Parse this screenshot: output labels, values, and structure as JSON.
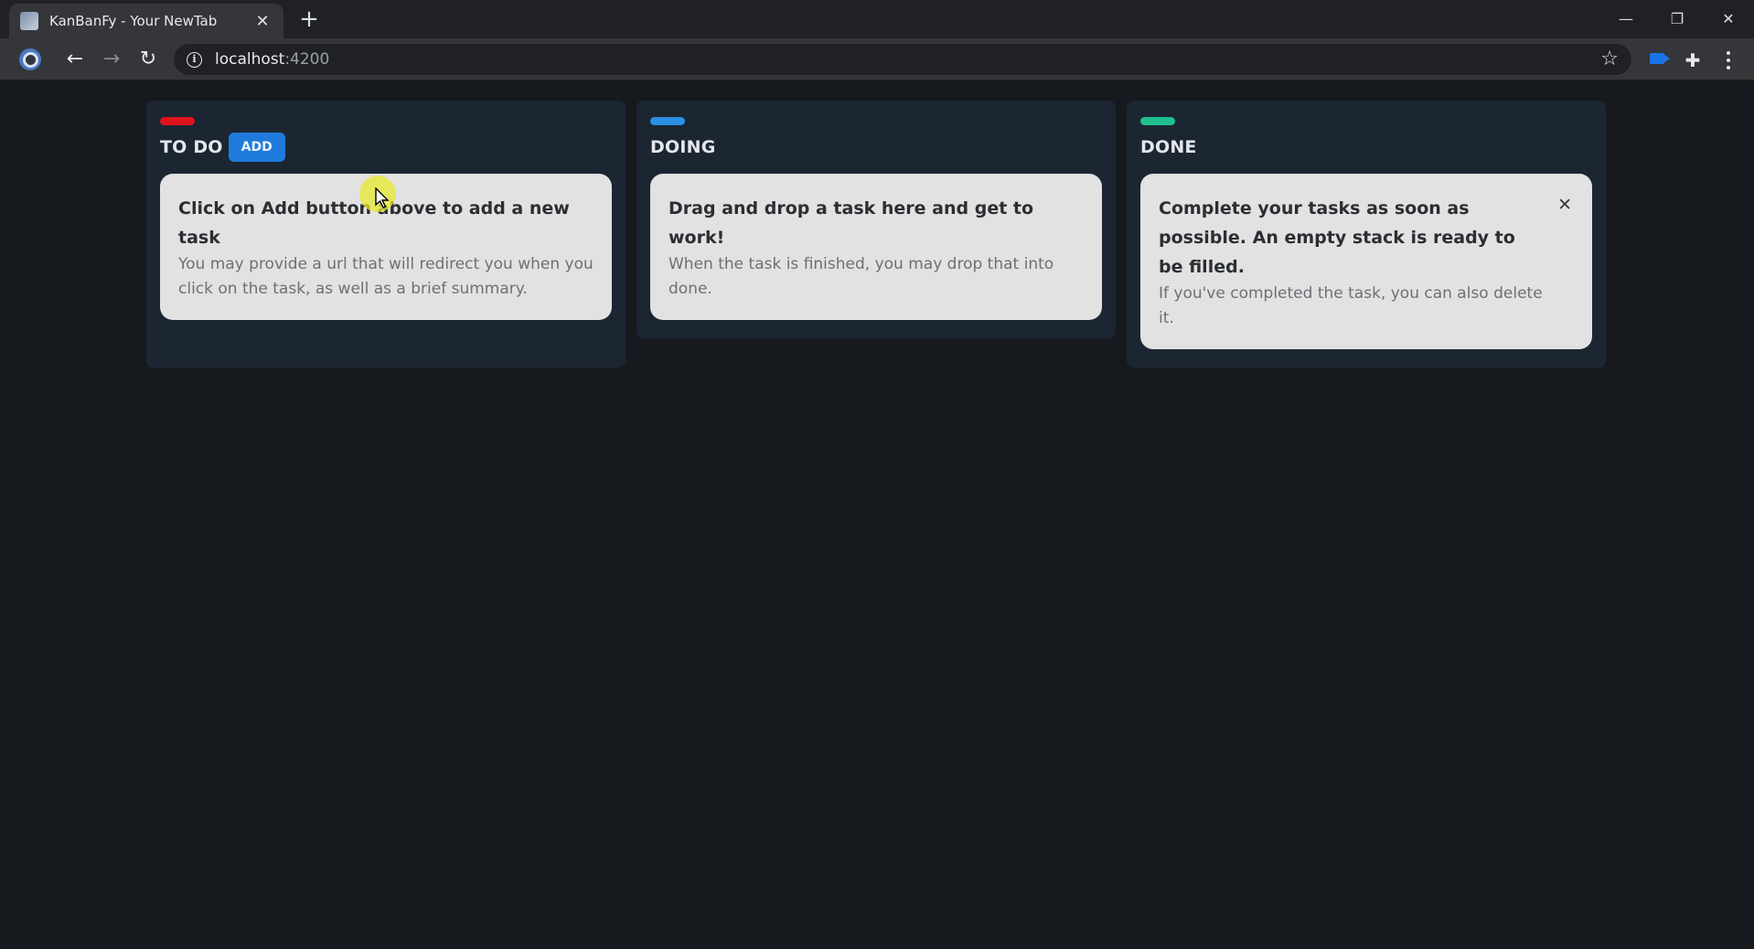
{
  "browser": {
    "tab_title": "KanBanFy - Your NewTab",
    "tab_close": "✕",
    "new_tab": "+",
    "url_host": "localhost",
    "url_port": ":4200",
    "window_controls": {
      "minimize": "—",
      "restore": "❐",
      "close": "✕"
    },
    "icons": {
      "back": "←",
      "forward": "→",
      "reload": "↻",
      "star": "☆",
      "extensions": "✚"
    }
  },
  "board": {
    "add_label": "ADD",
    "columns": [
      {
        "title": "TO DO",
        "color": "#e0131c",
        "cards": [
          {
            "title": "Click on Add button above to add a new task",
            "description": "You may provide a url that will redirect you when you click on the task, as well as a brief summary."
          }
        ]
      },
      {
        "title": "DOING",
        "color": "#2b8fe3",
        "cards": [
          {
            "title": "Drag and drop a task here and get to work!",
            "description": "When the task is finished, you may drop that into done."
          }
        ]
      },
      {
        "title": "DONE",
        "color": "#1fbf8f",
        "cards": [
          {
            "title": "Complete your tasks as soon as possible. An empty stack is ready to be filled.",
            "description": "If you've completed the task, you can also delete it.",
            "delete_label": "✕"
          }
        ]
      }
    ]
  }
}
